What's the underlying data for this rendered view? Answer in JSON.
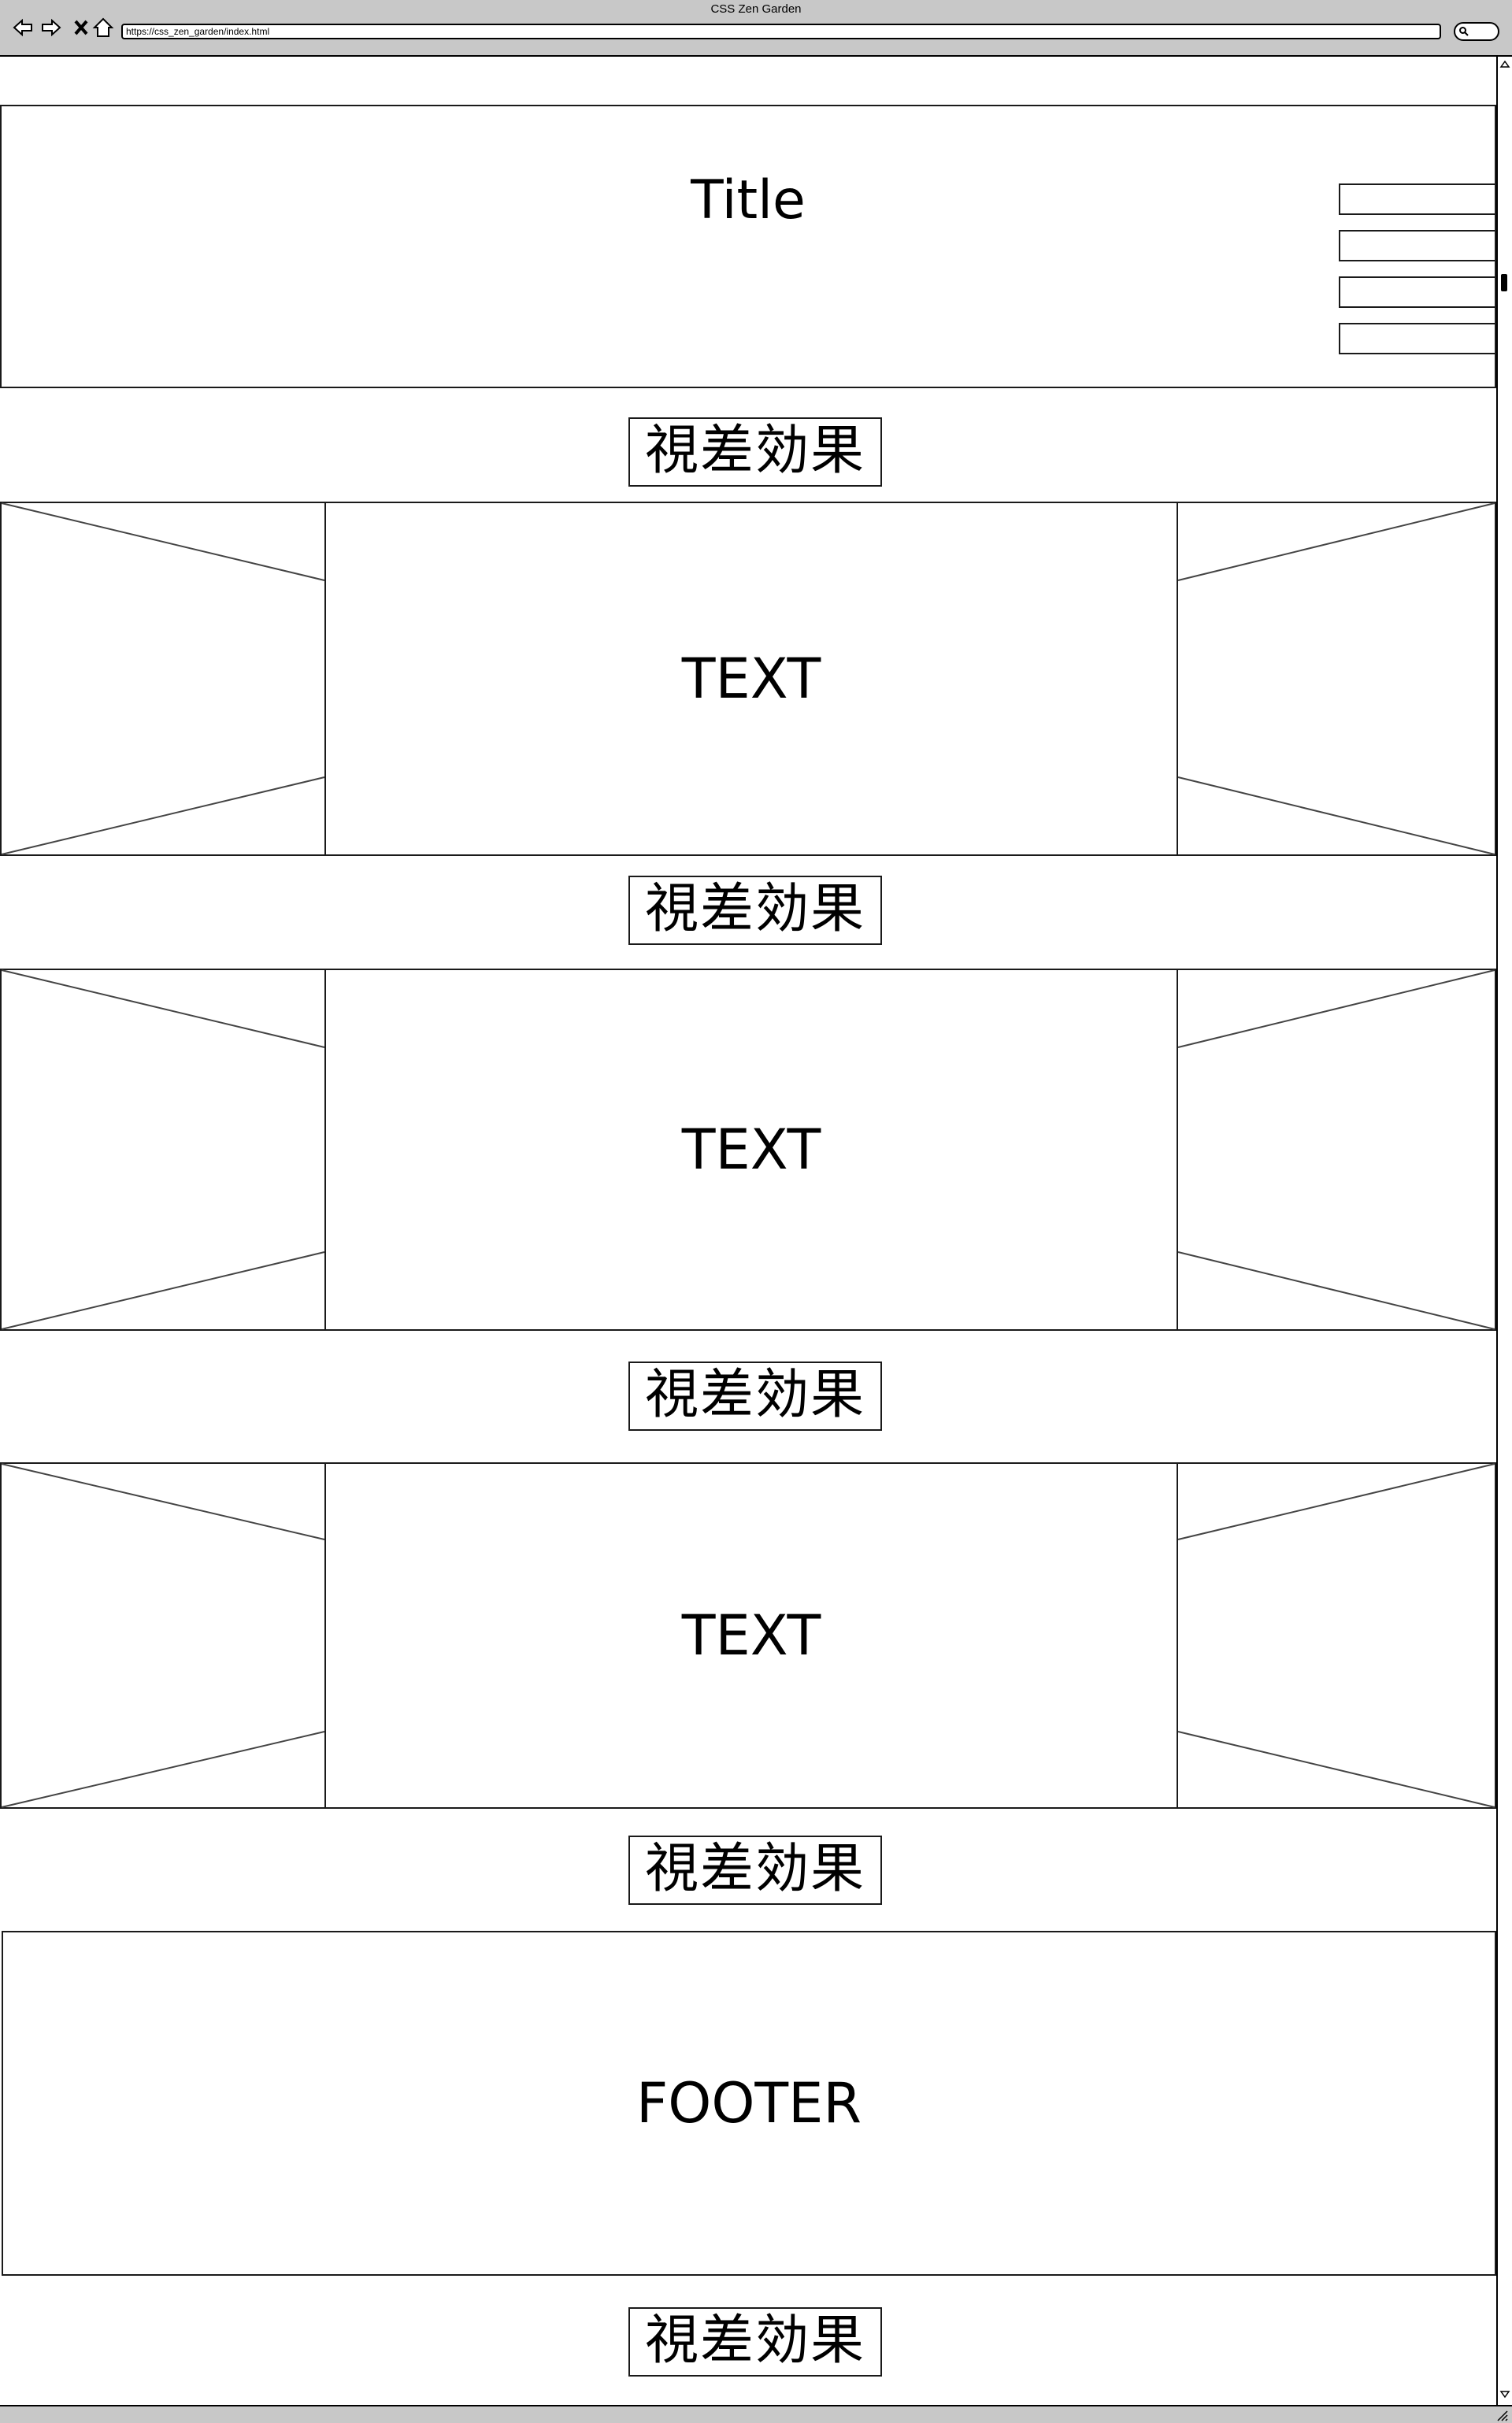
{
  "browser": {
    "window_title": "CSS Zen Garden",
    "url": "https://css_zen_garden/index.html"
  },
  "header": {
    "title": "Title",
    "nav_items": [
      "",
      "",
      "",
      ""
    ]
  },
  "parallax": {
    "label": "視差効果"
  },
  "sections": [
    {
      "text": "TEXT"
    },
    {
      "text": "TEXT"
    },
    {
      "text": "TEXT"
    }
  ],
  "footer": {
    "label": "FOOTER"
  }
}
